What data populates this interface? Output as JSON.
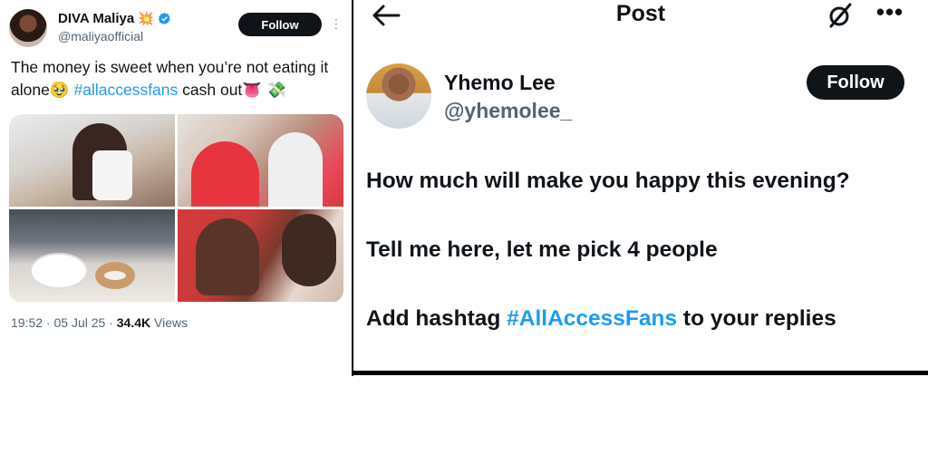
{
  "left_tweet": {
    "display_name": "DIVA Maliya",
    "name_emoji": "💥",
    "handle": "@maliyaofficial",
    "follow_label": "Follow",
    "text_before": "The money is sweet when you’re not eating it alone🥹 ",
    "hashtag": "#allaccessfans",
    "text_after": " cash out👅 💸",
    "time": "19:52 · 05 Jul 25 · ",
    "views_count": "34.4K",
    "views_label": " Views",
    "photos": [
      {
        "description_icon": "photo-1"
      },
      {
        "description_icon": "photo-2"
      },
      {
        "description_icon": "photo-3"
      },
      {
        "description_icon": "photo-4"
      }
    ],
    "colors": {
      "hashtag": "#1d9bf0",
      "verified": "#1d9bf0"
    }
  },
  "right_post": {
    "header_title": "Post",
    "display_name": "Yhemo Lee",
    "handle": "@yhemolee_",
    "follow_label": "Follow",
    "line1": "How much will make you happy this evening?",
    "line2": "Tell me here, let me pick 4 people",
    "line3_before": "Add hashtag ",
    "line3_hashtag": "#AllAccessFans",
    "line3_after": " to your replies",
    "icons": [
      "back-arrow-icon",
      "grok-icon",
      "more-icon"
    ]
  }
}
